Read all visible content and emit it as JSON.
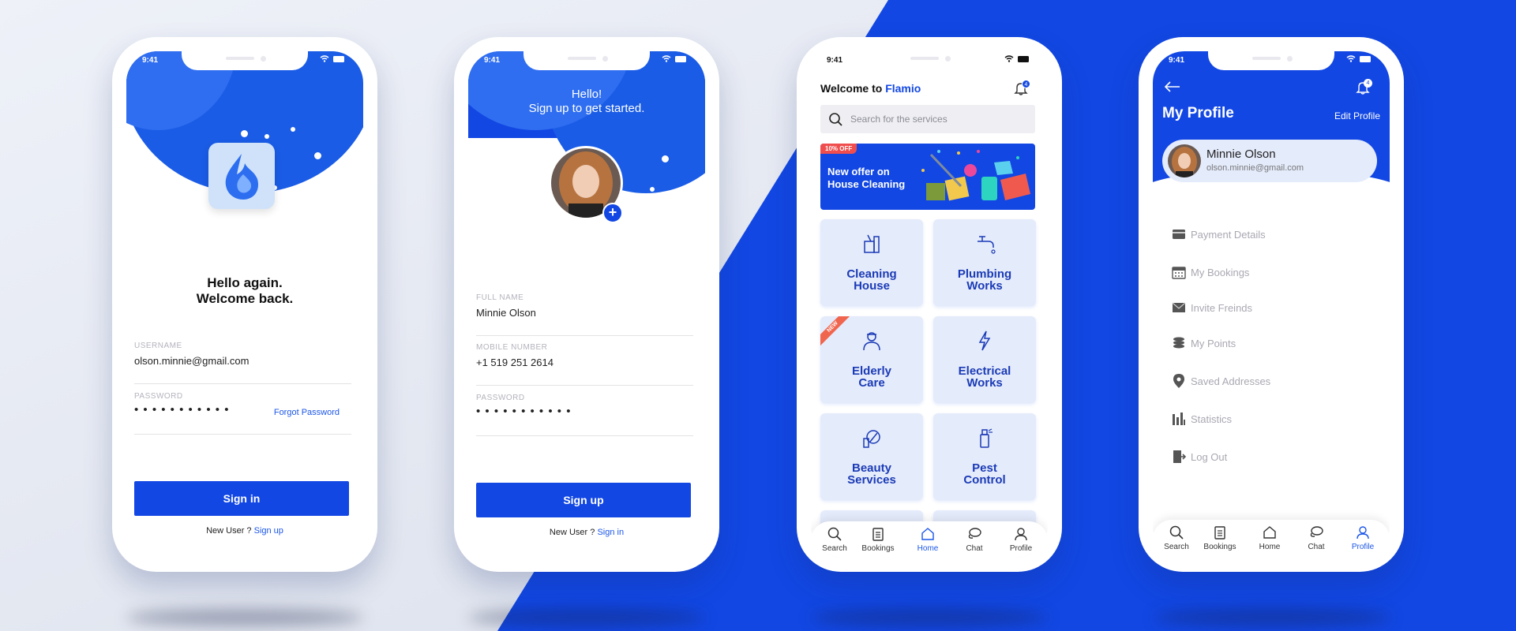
{
  "colors": {
    "primary": "#1247e3",
    "accent_link": "#1b56e8",
    "card_bg": "#e4ebfb",
    "badge_red": "#f04e4e"
  },
  "status_time": "9:41",
  "login": {
    "title_line1": "Hello again.",
    "title_line2": "Welcome back.",
    "username_label": "USERNAME",
    "username_value": "olson.minnie@gmail.com",
    "password_label": "PASSWORD",
    "password_value": "• • • • • • • • • • •",
    "forgot_label": "Forgot Password",
    "signin_button": "Sign in",
    "footer_text": "New User ?",
    "footer_link": "Sign up"
  },
  "signup": {
    "greeting": "Hello!",
    "subtitle": "Sign up to get started.",
    "avatar_add_label": "+",
    "fullname_label": "FULL NAME",
    "fullname_value": "Minnie Olson",
    "mobile_label": "MOBILE NUMBER",
    "mobile_value": "+1 519 251 2614",
    "password_label": "PASSWORD",
    "password_value": "• • • • • • • • • • •",
    "signup_button": "Sign up",
    "footer_text": "New User ?",
    "footer_link": "Sign in"
  },
  "home": {
    "welcome": "Welcome to",
    "brand": "Flamio",
    "notif_count": "4",
    "search_placeholder": "Search for the services",
    "banner_tag": "10% OFF",
    "banner_line1": "New offer on",
    "banner_line2": "House Cleaning",
    "new_ribbon": "NEW",
    "services": [
      {
        "line1": "Cleaning",
        "line2": "House",
        "icon": "cleaning-icon"
      },
      {
        "line1": "Plumbing",
        "line2": "Works",
        "icon": "faucet-icon"
      },
      {
        "line1": "Elderly",
        "line2": "Care",
        "icon": "caregiver-icon"
      },
      {
        "line1": "Electrical",
        "line2": "Works",
        "icon": "lightning-icon"
      },
      {
        "line1": "Beauty",
        "line2": "Services",
        "icon": "beauty-icon"
      },
      {
        "line1": "Pest",
        "line2": "Control",
        "icon": "spray-icon"
      }
    ]
  },
  "profile": {
    "title": "My Profile",
    "edit_label": "Edit Profile",
    "notif_count": "4",
    "user_name": "Minnie Olson",
    "user_email": "olson.minnie@gmail.com",
    "menu": [
      {
        "label": "Payment Details",
        "icon": "credit-card-icon"
      },
      {
        "label": "My Bookings",
        "icon": "calendar-icon"
      },
      {
        "label": "Invite Freinds",
        "icon": "envelope-icon"
      },
      {
        "label": "My Points",
        "icon": "coins-icon"
      },
      {
        "label": "Saved Addresses",
        "icon": "location-pin-icon"
      },
      {
        "label": "Statistics",
        "icon": "statistics-icon"
      },
      {
        "label": "Log Out",
        "icon": "logout-icon"
      }
    ]
  },
  "tabbar": {
    "items": [
      {
        "label": "Search",
        "icon": "search-icon"
      },
      {
        "label": "Bookings",
        "icon": "bookings-icon"
      },
      {
        "label": "Home",
        "icon": "home-icon"
      },
      {
        "label": "Chat",
        "icon": "chat-icon"
      },
      {
        "label": "Profile",
        "icon": "profile-icon"
      }
    ]
  }
}
